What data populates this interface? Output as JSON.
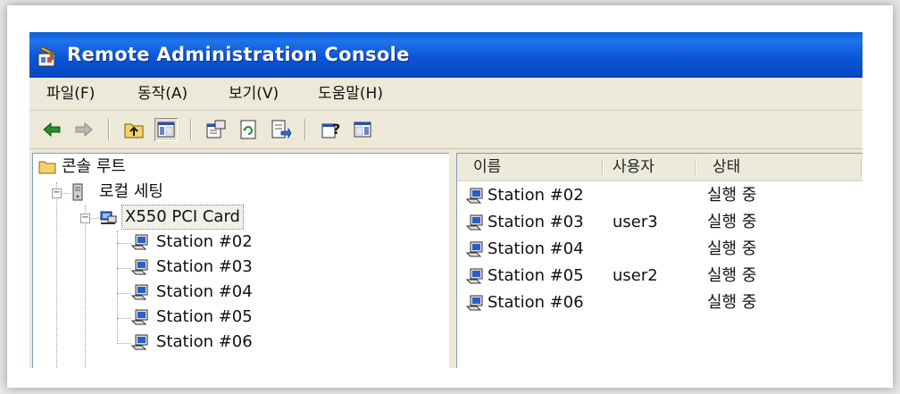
{
  "window": {
    "title": "Remote Administration Console"
  },
  "menu": [
    {
      "label": "파일(F)"
    },
    {
      "label": "동작(A)"
    },
    {
      "label": "보기(V)"
    },
    {
      "label": "도움말(H)"
    }
  ],
  "toolbar": {
    "buttons": [
      "back-arrow",
      "forward-arrow",
      "up-folder",
      "show-hide-tree",
      "properties",
      "refresh",
      "export-list",
      "help",
      "show-hide-action-pane"
    ]
  },
  "tree": {
    "root": "콘솔 루트",
    "local": "로컬 세팅",
    "card": "X550 PCI Card",
    "stations": [
      "Station #02",
      "Station #03",
      "Station #04",
      "Station #05",
      "Station #06"
    ]
  },
  "list": {
    "columns": {
      "name": "이름",
      "user": "사용자",
      "status": "상태"
    },
    "rows": [
      {
        "name": "Station #02",
        "user": "",
        "status": "실행 중"
      },
      {
        "name": "Station #03",
        "user": "user3",
        "status": "실행 중"
      },
      {
        "name": "Station #04",
        "user": "",
        "status": "실행 중"
      },
      {
        "name": "Station #05",
        "user": "user2",
        "status": "실행 중"
      },
      {
        "name": "Station #06",
        "user": "",
        "status": "실행 중"
      }
    ]
  },
  "colors": {
    "titlebar": "#0b56d8",
    "chrome": "#ece9d8",
    "pane": "#ffffff"
  }
}
